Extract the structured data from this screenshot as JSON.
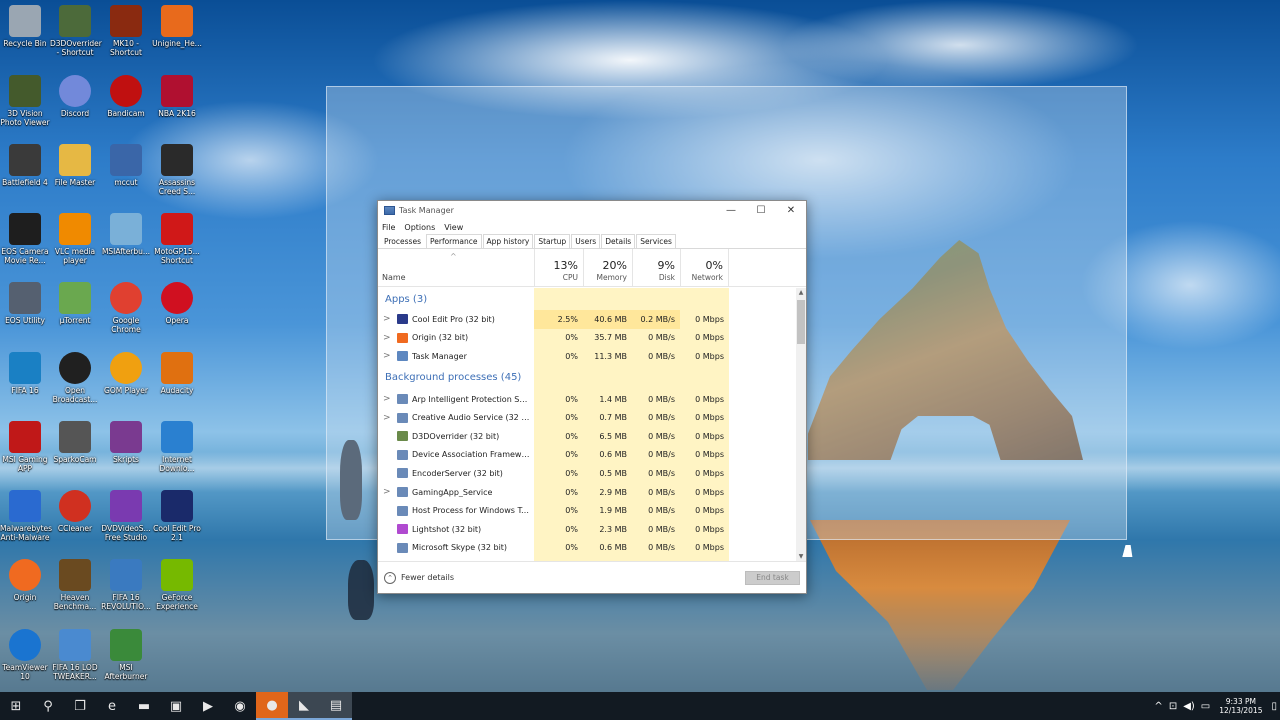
{
  "desktop": {
    "icons": [
      {
        "label": "Recycle Bin",
        "icon": "recycle-bin-icon",
        "color": "#9aa6b2"
      },
      {
        "label": "D3DOverrider - Shortcut",
        "icon": "d3doverrider-icon",
        "color": "#4c6a3a"
      },
      {
        "label": "MK10 - Shortcut",
        "icon": "mk10-icon",
        "color": "#8a2a10"
      },
      {
        "label": "Unigine_He...",
        "icon": "firefox-icon",
        "color": "#e86a1c"
      },
      {
        "label": "3D Vision Photo Viewer",
        "icon": "3d-vision-icon",
        "color": "#445a2c"
      },
      {
        "label": "Discord",
        "icon": "discord-icon",
        "color": "#7289da"
      },
      {
        "label": "Bandicam",
        "icon": "bandicam-icon",
        "color": "#c01010"
      },
      {
        "label": "NBA 2K16",
        "icon": "nba2k16-icon",
        "color": "#b01030"
      },
      {
        "label": "Battlefield 4",
        "icon": "battlefield-icon",
        "color": "#3a3a3a"
      },
      {
        "label": "File Master",
        "icon": "folder-icon",
        "color": "#e6b844"
      },
      {
        "label": "mccut",
        "icon": "scissors-icon",
        "color": "#3a66a8"
      },
      {
        "label": "Assassins Creed S...",
        "icon": "assassins-creed-icon",
        "color": "#2a2a2a"
      },
      {
        "label": "EOS Camera Movie Re...",
        "icon": "eos-camera-icon",
        "color": "#1e1e1e"
      },
      {
        "label": "VLC media player",
        "icon": "vlc-icon",
        "color": "#f08a00"
      },
      {
        "label": "MSIAfterbu...",
        "icon": "msi-afterburner-notes-icon",
        "color": "#7ab0d8"
      },
      {
        "label": "MotoGP15... Shortcut",
        "icon": "motogp-icon",
        "color": "#d01818"
      },
      {
        "label": "EOS Utility",
        "icon": "eos-utility-icon",
        "color": "#556070"
      },
      {
        "label": "µTorrent",
        "icon": "utorrent-icon",
        "color": "#6aa84f"
      },
      {
        "label": "Google Chrome",
        "icon": "chrome-icon",
        "color": "#e04030"
      },
      {
        "label": "Opera",
        "icon": "opera-icon",
        "color": "#d01020"
      },
      {
        "label": "FIFA 16",
        "icon": "fifa16-icon",
        "color": "#1a80c4"
      },
      {
        "label": "Open Broadcast...",
        "icon": "obs-icon",
        "color": "#202020"
      },
      {
        "label": "GOM Player",
        "icon": "gom-player-icon",
        "color": "#f0a010"
      },
      {
        "label": "Audacity",
        "icon": "audacity-icon",
        "color": "#e07010"
      },
      {
        "label": "MSI Gaming APP",
        "icon": "msi-gaming-icon",
        "color": "#c01818"
      },
      {
        "label": "SparkoCam",
        "icon": "sparkocam-icon",
        "color": "#555555"
      },
      {
        "label": "Skripts",
        "icon": "winrar-icon",
        "color": "#7a3a90"
      },
      {
        "label": "Internet Downlo...",
        "icon": "internet-download-manager-icon",
        "color": "#2a80d0"
      },
      {
        "label": "Malwarebytes Anti-Malware",
        "icon": "malwarebytes-icon",
        "color": "#2a6ad0"
      },
      {
        "label": "CCleaner",
        "icon": "ccleaner-icon",
        "color": "#d03020"
      },
      {
        "label": "DVDVideoS... Free Studio",
        "icon": "dvd-video-soft-icon",
        "color": "#7a3ab0"
      },
      {
        "label": "Cool Edit Pro 2.1",
        "icon": "cool-edit-pro-icon",
        "color": "#1a2a6a"
      },
      {
        "label": "Origin",
        "icon": "origin-icon",
        "color": "#f06a20"
      },
      {
        "label": "Heaven Benchma...",
        "icon": "heaven-benchmark-icon",
        "color": "#6a4a20"
      },
      {
        "label": "FIFA 16 REVOLUTIO...",
        "icon": "fifa16-revolution-icon",
        "color": "#3a7ac0"
      },
      {
        "label": "GeForce Experience",
        "icon": "geforce-icon",
        "color": "#76b900"
      },
      {
        "label": "TeamViewer 10",
        "icon": "teamviewer-icon",
        "color": "#1a74d0"
      },
      {
        "label": "FIFA 16 LOD TWEAKER...",
        "icon": "fifa16-lod-tweaker-icon",
        "color": "#4a8ad0"
      },
      {
        "label": "MSI Afterburner",
        "icon": "msi-afterburner-icon",
        "color": "#3a8a3a"
      }
    ]
  },
  "task_manager": {
    "title": "Task Manager",
    "window_buttons": {
      "minimize": "—",
      "maximize": "☐",
      "close": "✕"
    },
    "menu": [
      "File",
      "Options",
      "View"
    ],
    "tabs": [
      "Processes",
      "Performance",
      "App history",
      "Startup",
      "Users",
      "Details",
      "Services"
    ],
    "columns": {
      "name": "Name",
      "sort_arrow": "^",
      "cpu": {
        "pct": "13%",
        "label": "CPU"
      },
      "memory": {
        "pct": "20%",
        "label": "Memory"
      },
      "disk": {
        "pct": "9%",
        "label": "Disk"
      },
      "network": {
        "pct": "0%",
        "label": "Network"
      }
    },
    "apps_group": "Apps (3)",
    "apps": [
      {
        "name": "Cool Edit Pro (32 bit)",
        "cpu": "2.5%",
        "mem": "40.6 MB",
        "disk": "0.2 MB/s",
        "net": "0 Mbps",
        "expand": ">",
        "icon": "cool-edit-icon",
        "color": "#2a3a8a"
      },
      {
        "name": "Origin (32 bit)",
        "cpu": "0%",
        "mem": "35.7 MB",
        "disk": "0 MB/s",
        "net": "0 Mbps",
        "expand": ">",
        "icon": "origin-icon",
        "color": "#f06a20"
      },
      {
        "name": "Task Manager",
        "cpu": "0%",
        "mem": "11.3 MB",
        "disk": "0 MB/s",
        "net": "0 Mbps",
        "expand": ">",
        "icon": "task-manager-icon",
        "color": "#5d87c0"
      }
    ],
    "bg_group": "Background processes (45)",
    "background": [
      {
        "name": "Arp Intelligent Protection Servic...",
        "cpu": "0%",
        "mem": "1.4 MB",
        "disk": "0 MB/s",
        "net": "0 Mbps",
        "expand": ">",
        "icon": "service-icon",
        "color": "#6a8ab8"
      },
      {
        "name": "Creative Audio Service (32 bit)",
        "cpu": "0%",
        "mem": "0.7 MB",
        "disk": "0 MB/s",
        "net": "0 Mbps",
        "expand": ">",
        "icon": "service-icon",
        "color": "#6a8ab8"
      },
      {
        "name": "D3DOverrider (32 bit)",
        "cpu": "0%",
        "mem": "6.5 MB",
        "disk": "0 MB/s",
        "net": "0 Mbps",
        "expand": "",
        "icon": "d3doverrider-icon",
        "color": "#6a8a4a"
      },
      {
        "name": "Device Association Framework ...",
        "cpu": "0%",
        "mem": "0.6 MB",
        "disk": "0 MB/s",
        "net": "0 Mbps",
        "expand": "",
        "icon": "service-icon",
        "color": "#6a8ab8"
      },
      {
        "name": "EncoderServer (32 bit)",
        "cpu": "0%",
        "mem": "0.5 MB",
        "disk": "0 MB/s",
        "net": "0 Mbps",
        "expand": "",
        "icon": "service-icon",
        "color": "#6a8ab8"
      },
      {
        "name": "GamingApp_Service",
        "cpu": "0%",
        "mem": "2.9 MB",
        "disk": "0 MB/s",
        "net": "0 Mbps",
        "expand": ">",
        "icon": "service-icon",
        "color": "#6a8ab8"
      },
      {
        "name": "Host Process for Windows Tasks",
        "cpu": "0%",
        "mem": "1.9 MB",
        "disk": "0 MB/s",
        "net": "0 Mbps",
        "expand": "",
        "icon": "service-icon",
        "color": "#6a8ab8"
      },
      {
        "name": "Lightshot (32 bit)",
        "cpu": "0%",
        "mem": "2.3 MB",
        "disk": "0 MB/s",
        "net": "0 Mbps",
        "expand": "",
        "icon": "lightshot-icon",
        "color": "#b04ad0"
      },
      {
        "name": "Microsoft Skype (32 bit)",
        "cpu": "0%",
        "mem": "0.6 MB",
        "disk": "0 MB/s",
        "net": "0 Mbps",
        "expand": "",
        "icon": "skype-icon",
        "color": "#6a8ab8"
      }
    ],
    "fewer_details": "Fewer details",
    "end_task": "End task"
  },
  "taskbar": {
    "items": [
      {
        "icon": "start-icon",
        "glyph": "⊞"
      },
      {
        "icon": "search-icon",
        "glyph": "⚲"
      },
      {
        "icon": "task-view-icon",
        "glyph": "❐"
      },
      {
        "icon": "edge-icon",
        "glyph": "e"
      },
      {
        "icon": "file-explorer-icon",
        "glyph": "▬"
      },
      {
        "icon": "store-icon",
        "glyph": "▣"
      },
      {
        "icon": "media-player-icon",
        "glyph": "▶"
      },
      {
        "icon": "obs-icon",
        "glyph": "◉"
      },
      {
        "icon": "origin-icon",
        "glyph": "●"
      },
      {
        "icon": "cool-edit-pro-icon",
        "glyph": "◣"
      },
      {
        "icon": "task-manager-icon",
        "glyph": "▤"
      }
    ],
    "tray": {
      "chevron": "^",
      "network": "⊡",
      "volume": "◀)",
      "keyboard": "▭",
      "time": "9:33 PM",
      "date": "12/13/2015",
      "notifications": "▯"
    }
  }
}
